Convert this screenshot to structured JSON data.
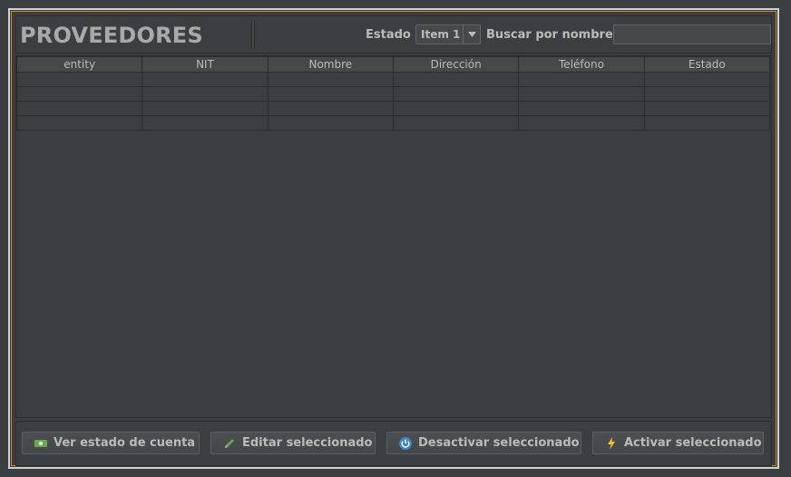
{
  "header": {
    "title": "PROVEEDORES",
    "estado_label": "Estado",
    "estado_value": "Item 1",
    "buscar_label": "Buscar por nombre",
    "search_value": ""
  },
  "table": {
    "columns": [
      "entity",
      "NIT",
      "Nombre",
      "Dirección",
      "Teléfono",
      "Estado"
    ],
    "empty_row_count": 4
  },
  "buttons": {
    "ver_estado": "Ver estado de cuenta",
    "editar": "Editar seleccionado",
    "desactivar": "Desactivar seleccionado",
    "activar": "Activar seleccionado"
  },
  "colors": {
    "background": "#3c3f41",
    "accent_border": "#c68a2a",
    "text": "#bbbbbb",
    "title": "#a9a9a9"
  },
  "icons": [
    "money-icon",
    "pencil-icon",
    "power-icon",
    "lightning-icon",
    "chevron-down-icon"
  ]
}
